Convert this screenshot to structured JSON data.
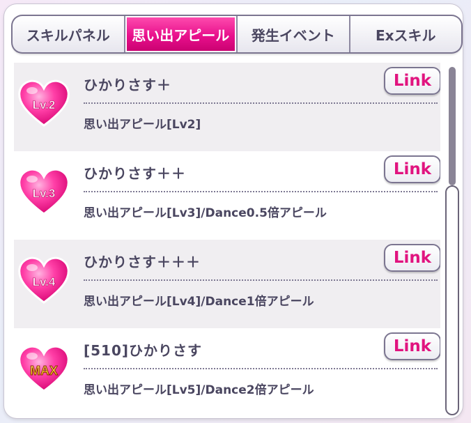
{
  "tabs": [
    {
      "label": "スキルパネル",
      "active": false
    },
    {
      "label": "思い出アピール",
      "active": true
    },
    {
      "label": "発生イベント",
      "active": false
    },
    {
      "label": "Exスキル",
      "active": false
    }
  ],
  "items": [
    {
      "badge": "Lv.2",
      "title": "ひかりさす＋",
      "description": "思い出アピール[Lv2]",
      "link_label": "Link"
    },
    {
      "badge": "Lv.3",
      "title": "ひかりさす＋＋",
      "description": "思い出アピール[Lv3]/Dance0.5倍アピール",
      "link_label": "Link"
    },
    {
      "badge": "Lv.4",
      "title": "ひかりさす＋＋＋",
      "description": "思い出アピール[Lv4]/Dance1倍アピール",
      "link_label": "Link"
    },
    {
      "badge": "MAX",
      "title": "[510]ひかりさす",
      "description": "思い出アピール[Lv5]/Dance2倍アピール",
      "link_label": "Link"
    }
  ],
  "colors": {
    "accent": "#e8108c",
    "text": "#4a4660",
    "link": "#e1147f"
  }
}
